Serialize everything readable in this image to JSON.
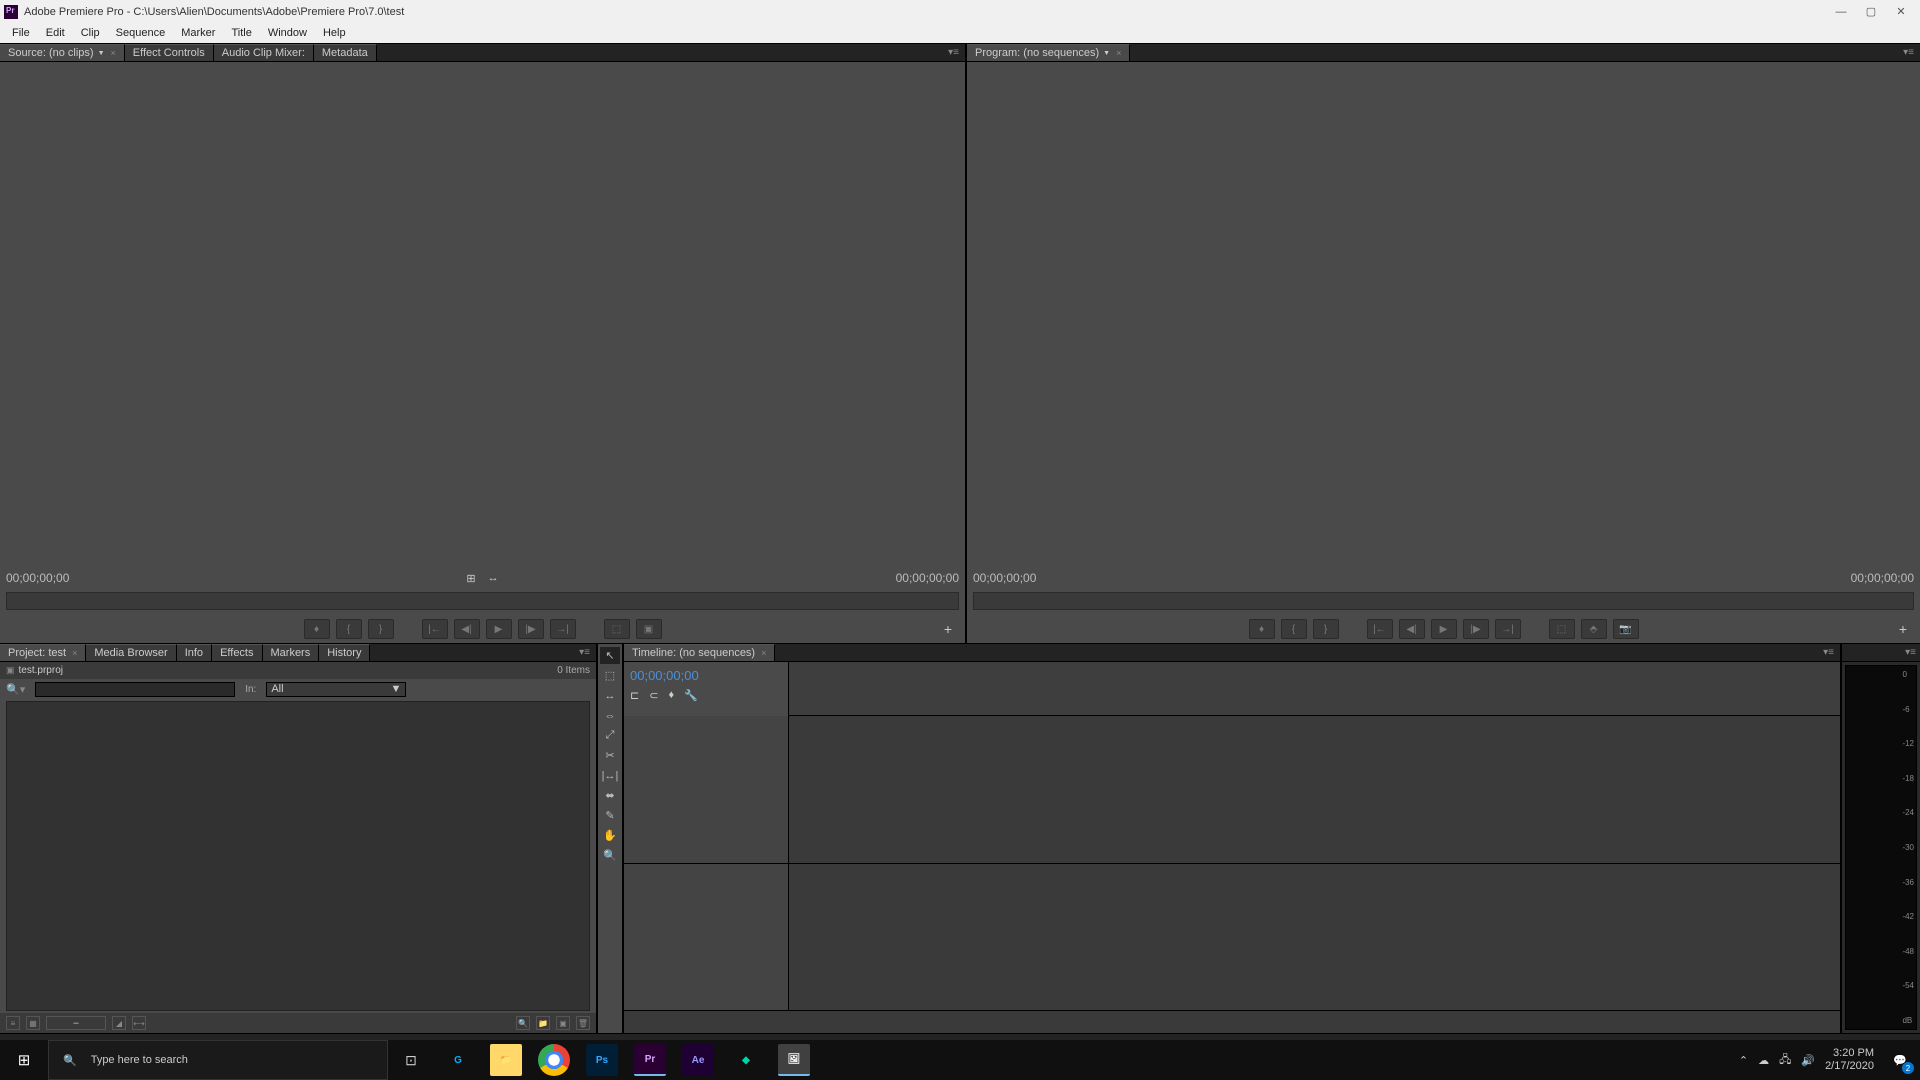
{
  "titlebar": {
    "title": "Adobe Premiere Pro - C:\\Users\\Alien\\Documents\\Adobe\\Premiere Pro\\7.0\\test"
  },
  "menu": {
    "items": [
      "File",
      "Edit",
      "Clip",
      "Sequence",
      "Marker",
      "Title",
      "Window",
      "Help"
    ]
  },
  "source": {
    "tab_label": "Source: (no clips)",
    "tabs": [
      "Effect Controls",
      "Audio Clip Mixer:",
      "Metadata"
    ],
    "tc_left": "00;00;00;00",
    "tc_right": "00;00;00;00"
  },
  "program": {
    "tab_label": "Program: (no sequences)",
    "tc_left": "00;00;00;00",
    "tc_right": "00;00;00;00"
  },
  "transport": {
    "mark_in": "{",
    "mark_out": "}",
    "goto_in": "|←",
    "step_back": "◀|",
    "play": "▶",
    "step_fwd": "|▶",
    "goto_out": "→|",
    "lift": "⬚",
    "extract": "📷",
    "add": "+"
  },
  "project": {
    "tab_label": "Project: test",
    "tabs": [
      "Media Browser",
      "Info",
      "Effects",
      "Markers",
      "History"
    ],
    "filename": "test.prproj",
    "item_count": "0 Items",
    "in_label": "In:",
    "filter_value": "All"
  },
  "timeline": {
    "tab_label": "Timeline: (no sequences)",
    "timecode": "00;00;00;00"
  },
  "meter": {
    "ticks": [
      "0",
      "-6",
      "-12",
      "-18",
      "-24",
      "-30",
      "-36",
      "-42",
      "-48",
      "-54",
      "dB"
    ]
  },
  "taskbar": {
    "search_placeholder": "Type here to search",
    "time": "3:20 PM",
    "date": "2/17/2020",
    "notif_count": "2"
  }
}
